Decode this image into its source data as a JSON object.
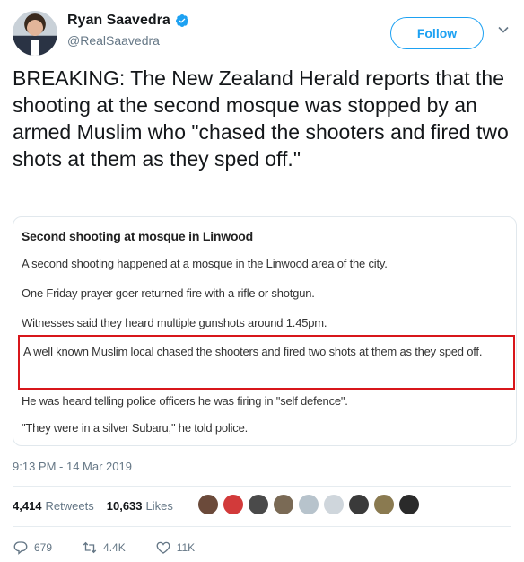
{
  "author": {
    "display_name": "Ryan Saavedra",
    "handle": "@RealSaavedra",
    "verified": true
  },
  "follow_button": {
    "label": "Follow"
  },
  "tweet": {
    "text": "BREAKING: The New Zealand Herald reports that the shooting at the second mosque was stopped by an armed Muslim who \"chased the shooters and fired two shots at them as they sped off.\""
  },
  "article": {
    "title": "Second shooting at mosque in Linwood",
    "paragraphs": [
      "A second shooting happened at a mosque in the Linwood area of the city.",
      "One Friday prayer goer returned fire with a rifle or shotgun.",
      "Witnesses said they heard multiple gunshots around 1.45pm.",
      "A well known Muslim local chased the shooters and fired two shots at them as they sped off.",
      "He was heard telling police officers he was firing in \"self defence\".",
      "\"They were in a silver Subaru,\" he told police."
    ],
    "highlight_color": "#d8161b"
  },
  "timestamp": "9:13 PM - 14 Mar 2019",
  "stats": {
    "retweets_count": "4,414",
    "retweets_label": "Retweets",
    "likes_count": "10,633",
    "likes_label": "Likes",
    "liker_avatar_colors": [
      "#6b4a3a",
      "#d23a3a",
      "#4a4a4a",
      "#7a6a55",
      "#b7c3cc",
      "#cfd6dc",
      "#3a3a3a",
      "#8a7a50",
      "#2a2a2a"
    ]
  },
  "actions": {
    "replies": "679",
    "retweets": "4.4K",
    "likes": "11K"
  },
  "colors": {
    "accent": "#1da1f2",
    "muted": "#657786",
    "text": "#14171a"
  }
}
